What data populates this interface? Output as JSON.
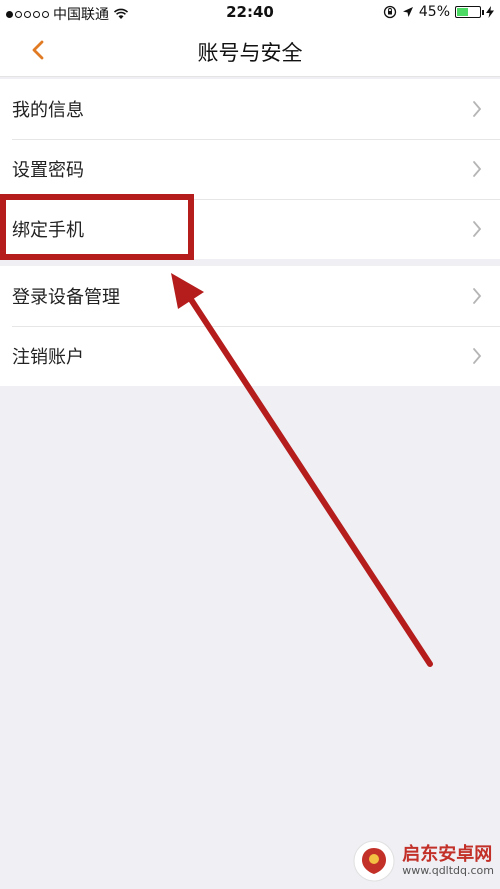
{
  "status_bar": {
    "carrier": "中国联通",
    "time": "22:40",
    "battery_percent": "45%",
    "signal_dots_filled": 1,
    "signal_dots_total": 5
  },
  "nav": {
    "title": "账号与安全",
    "accent_color": "#e07b24"
  },
  "menu_groups": [
    {
      "items": [
        {
          "label": "我的信息"
        },
        {
          "label": "设置密码"
        },
        {
          "label": "绑定手机"
        }
      ]
    },
    {
      "items": [
        {
          "label": "登录设备管理"
        },
        {
          "label": "注销账户"
        }
      ]
    }
  ],
  "annotation": {
    "highlighted_item": "绑定手机",
    "color": "#b51d1d"
  },
  "watermark": {
    "brand_text": "启东安卓网",
    "url": "www.qdltdq.com"
  }
}
